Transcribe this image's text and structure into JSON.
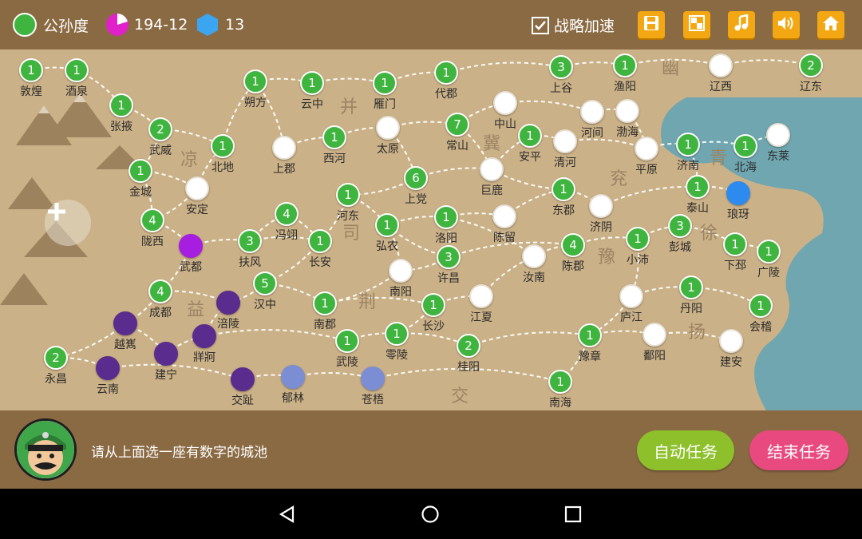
{
  "players": [
    {
      "name": "公孙度",
      "color": "#3fb53f"
    },
    {
      "name": "194-12",
      "color": "#e020c8"
    },
    {
      "name": "13",
      "color": "#3ba5f0"
    }
  ],
  "toolbar": {
    "speed_label": "战略加速",
    "speed_checked": true
  },
  "regions": [
    "凉",
    "并",
    "幽",
    "冀",
    "青",
    "兖",
    "徐",
    "司",
    "豫",
    "益",
    "荆",
    "扬",
    "交"
  ],
  "cities": [
    {
      "name": "敦煌",
      "value": "1",
      "owner": "green"
    },
    {
      "name": "酒泉",
      "value": "1",
      "owner": "green"
    },
    {
      "name": "张掖",
      "value": "1",
      "owner": "green"
    },
    {
      "name": "武威",
      "value": "2",
      "owner": "green"
    },
    {
      "name": "北地",
      "value": "1",
      "owner": "green"
    },
    {
      "name": "金城",
      "value": "1",
      "owner": "green"
    },
    {
      "name": "安定",
      "value": "",
      "owner": "white"
    },
    {
      "name": "陇西",
      "value": "4",
      "owner": "green"
    },
    {
      "name": "武都",
      "value": "",
      "owner": "magenta"
    },
    {
      "name": "扶风",
      "value": "3",
      "owner": "green"
    },
    {
      "name": "冯翊",
      "value": "4",
      "owner": "green"
    },
    {
      "name": "长安",
      "value": "1",
      "owner": "green"
    },
    {
      "name": "汉中",
      "value": "5",
      "owner": "green"
    },
    {
      "name": "成都",
      "value": "4",
      "owner": "green"
    },
    {
      "name": "涪陵",
      "value": "",
      "owner": "purple"
    },
    {
      "name": "越嶲",
      "value": "",
      "owner": "purple"
    },
    {
      "name": "牂牁",
      "value": "",
      "owner": "purple"
    },
    {
      "name": "建宁",
      "value": "",
      "owner": "purple"
    },
    {
      "name": "永昌",
      "value": "2",
      "owner": "green"
    },
    {
      "name": "云南",
      "value": "",
      "owner": "purple"
    },
    {
      "name": "交趾",
      "value": "",
      "owner": "purple"
    },
    {
      "name": "郁林",
      "value": "",
      "owner": "slate"
    },
    {
      "name": "苍梧",
      "value": "",
      "owner": "slate"
    },
    {
      "name": "朔方",
      "value": "1",
      "owner": "green"
    },
    {
      "name": "云中",
      "value": "1",
      "owner": "green"
    },
    {
      "name": "雁门",
      "value": "1",
      "owner": "green"
    },
    {
      "name": "代郡",
      "value": "1",
      "owner": "green"
    },
    {
      "name": "上谷",
      "value": "3",
      "owner": "green"
    },
    {
      "name": "渔阳",
      "value": "1",
      "owner": "green"
    },
    {
      "name": "辽西",
      "value": "",
      "owner": "white"
    },
    {
      "name": "辽东",
      "value": "2",
      "owner": "green"
    },
    {
      "name": "西河",
      "value": "1",
      "owner": "green"
    },
    {
      "name": "上郡",
      "value": "",
      "owner": "white"
    },
    {
      "name": "太原",
      "value": "",
      "owner": "white"
    },
    {
      "name": "常山",
      "value": "7",
      "owner": "green"
    },
    {
      "name": "中山",
      "value": "",
      "owner": "white"
    },
    {
      "name": "河间",
      "value": "",
      "owner": "white"
    },
    {
      "name": "渤海",
      "value": "",
      "owner": "white"
    },
    {
      "name": "安平",
      "value": "1",
      "owner": "green"
    },
    {
      "name": "清河",
      "value": "",
      "owner": "white"
    },
    {
      "name": "平原",
      "value": "",
      "owner": "white"
    },
    {
      "name": "济南",
      "value": "1",
      "owner": "green"
    },
    {
      "name": "北海",
      "value": "1",
      "owner": "green"
    },
    {
      "name": "东莱",
      "value": "",
      "owner": "white"
    },
    {
      "name": "上党",
      "value": "6",
      "owner": "green"
    },
    {
      "name": "巨鹿",
      "value": "",
      "owner": "white"
    },
    {
      "name": "河东",
      "value": "1",
      "owner": "green"
    },
    {
      "name": "弘农",
      "value": "1",
      "owner": "green"
    },
    {
      "name": "洛阳",
      "value": "1",
      "owner": "green"
    },
    {
      "name": "陈留",
      "value": "",
      "owner": "white"
    },
    {
      "name": "东郡",
      "value": "1",
      "owner": "green"
    },
    {
      "name": "济阴",
      "value": "",
      "owner": "white"
    },
    {
      "name": "泰山",
      "value": "1",
      "owner": "green"
    },
    {
      "name": "琅玡",
      "value": "",
      "owner": "blue"
    },
    {
      "name": "许昌",
      "value": "3",
      "owner": "green"
    },
    {
      "name": "陈郡",
      "value": "4",
      "owner": "green"
    },
    {
      "name": "小沛",
      "value": "1",
      "owner": "green"
    },
    {
      "name": "彭城",
      "value": "3",
      "owner": "green"
    },
    {
      "name": "下邳",
      "value": "1",
      "owner": "green"
    },
    {
      "name": "广陵",
      "value": "1",
      "owner": "green"
    },
    {
      "name": "南阳",
      "value": "",
      "owner": "white"
    },
    {
      "name": "汝南",
      "value": "",
      "owner": "white"
    },
    {
      "name": "南郡",
      "value": "1",
      "owner": "green"
    },
    {
      "name": "长沙",
      "value": "1",
      "owner": "green"
    },
    {
      "name": "江夏",
      "value": "",
      "owner": "white"
    },
    {
      "name": "庐江",
      "value": "",
      "owner": "white"
    },
    {
      "name": "丹阳",
      "value": "1",
      "owner": "green"
    },
    {
      "name": "会稽",
      "value": "1",
      "owner": "green"
    },
    {
      "name": "武陵",
      "value": "1",
      "owner": "green"
    },
    {
      "name": "零陵",
      "value": "1",
      "owner": "green"
    },
    {
      "name": "桂阳",
      "value": "2",
      "owner": "green"
    },
    {
      "name": "豫章",
      "value": "1",
      "owner": "green"
    },
    {
      "name": "鄱阳",
      "value": "",
      "owner": "white"
    },
    {
      "name": "建安",
      "value": "",
      "owner": "white"
    },
    {
      "name": "南海",
      "value": "1",
      "owner": "green"
    }
  ],
  "message": "请从上面选一座有数字的城池",
  "buttons": {
    "auto": "自动任务",
    "end": "结束任务"
  },
  "colors": {
    "bar": "#8a6a43",
    "map": "#cbb187",
    "sea": "#6fa6b0",
    "auto": "#8ec02b",
    "end": "#e84a7f"
  }
}
